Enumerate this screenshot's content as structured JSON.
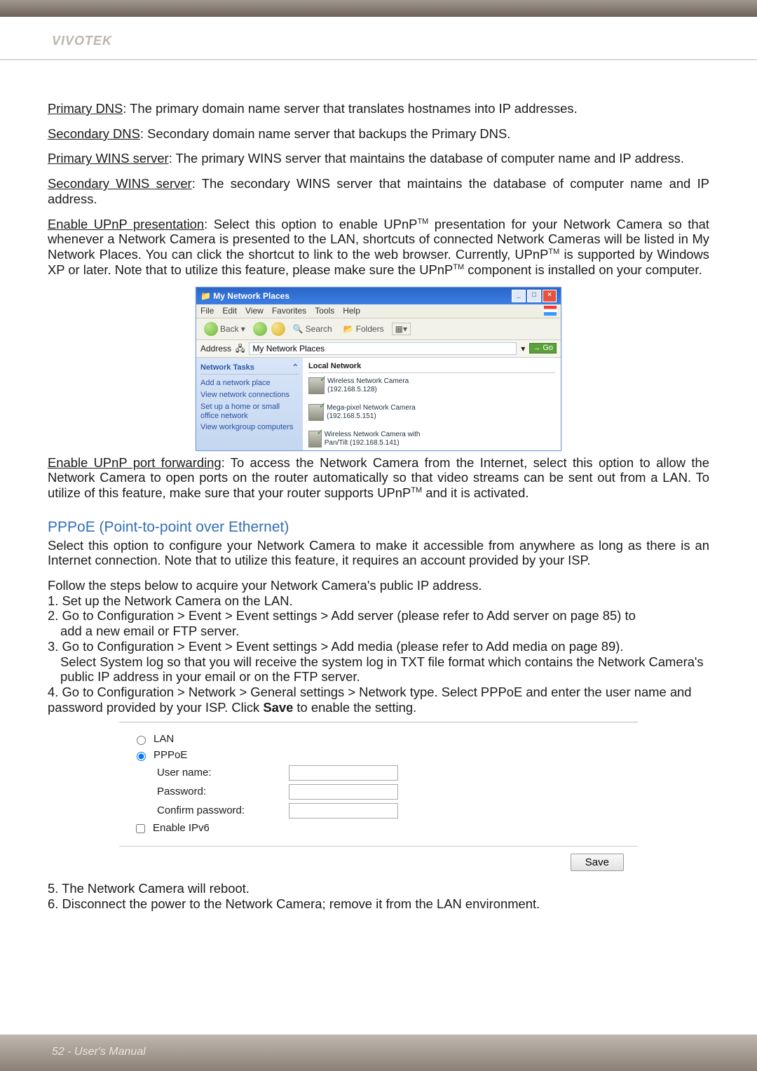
{
  "brand": "VIVOTEK",
  "defs": {
    "primary_dns_term": "Primary DNS",
    "primary_dns_text": ": The primary domain name server that translates hostnames into IP addresses.",
    "secondary_dns_term": "Secondary DNS",
    "secondary_dns_text": ": Secondary domain name server that backups the Primary DNS.",
    "primary_wins_term": "Primary WINS server",
    "primary_wins_text": ": The primary WINS server that maintains the database of computer name and IP address.",
    "secondary_wins_term": "Secondary WINS server",
    "secondary_wins_text": ": The secondary WINS server that maintains the database of computer name and IP address.",
    "upnp_present_term": "Enable UPnP presentation",
    "upnp_present_a": ": Select this option to enable UPnP",
    "upnp_present_b": " presentation for your Network Camera so that whenever a Network Camera is presented to the LAN, shortcuts of connected Network Cameras will be listed in My Network Places. You can click the shortcut to link to the web browser. Currently, UPnP",
    "upnp_present_c": " is supported by Windows XP or later. Note that to utilize this feature, please make sure the UPnP",
    "upnp_present_d": " component is installed on your computer.",
    "tm": "TM",
    "upnp_fwd_term": "Enable UPnP port forwarding",
    "upnp_fwd_a": ": To access the Network Camera from the Internet, select this option to allow the Network Camera to open ports on the router automatically so that video streams can be sent out from a LAN. To utilize of this feature, make sure that your router supports UPnP",
    "upnp_fwd_b": " and it is activated."
  },
  "xp": {
    "title": "My Network Places",
    "menu": [
      "File",
      "Edit",
      "View",
      "Favorites",
      "Tools",
      "Help"
    ],
    "toolbar": {
      "back": "Back",
      "search": "Search",
      "folders": "Folders"
    },
    "address_label": "Address",
    "address_value": "My Network Places",
    "go": "Go",
    "side_title": "Network Tasks",
    "tasks": [
      "Add a network place",
      "View network connections",
      "Set up a home or small office network",
      "View workgroup computers"
    ],
    "group": "Local Network",
    "items": [
      "Wireless Network Camera (192.168.5.128)",
      "Mega-pixel Network Camera (192.168.5.151)",
      "Wireless Network Camera with Pan/Tilt (192.168.5.141)"
    ]
  },
  "pppoe": {
    "title": "PPPoE (Point-to-point over Ethernet)",
    "intro": "Select this option to configure your Network Camera to make it accessible from anywhere as long as there is an Internet connection. Note that to utilize this feature, it requires an account provided by your ISP.",
    "follow": "Follow the steps below to acquire your Network Camera's public IP address.",
    "step1": "1. Set up the Network Camera on the LAN.",
    "step2a": "2. Go to Configuration > Event > Event settings > Add server (please refer to Add server on page 85) to",
    "step2b": "add a new email or FTP server.",
    "step3a": "3. Go to Configuration > Event > Event settings > Add media (please refer to Add media on page 89).",
    "step3b": "Select System log so that you will receive the system log in TXT file format which contains the Network Camera's public IP address in your email or on the FTP server.",
    "step4a": "4. Go to Configuration > Network > General settings > Network type. Select PPPoE and enter the user name and password provided by your ISP. Click ",
    "step4b": " to enable the setting.",
    "saveword": "Save",
    "step5": "5. The Network Camera will reboot.",
    "step6": "6. Disconnect the power to the Network Camera; remove it from the LAN environment."
  },
  "form": {
    "lan": "LAN",
    "pppoe": "PPPoE",
    "username": "User name:",
    "password": "Password:",
    "confirm": "Confirm password:",
    "ipv6": "Enable IPv6",
    "save": "Save"
  },
  "footer": "52 - User's Manual"
}
